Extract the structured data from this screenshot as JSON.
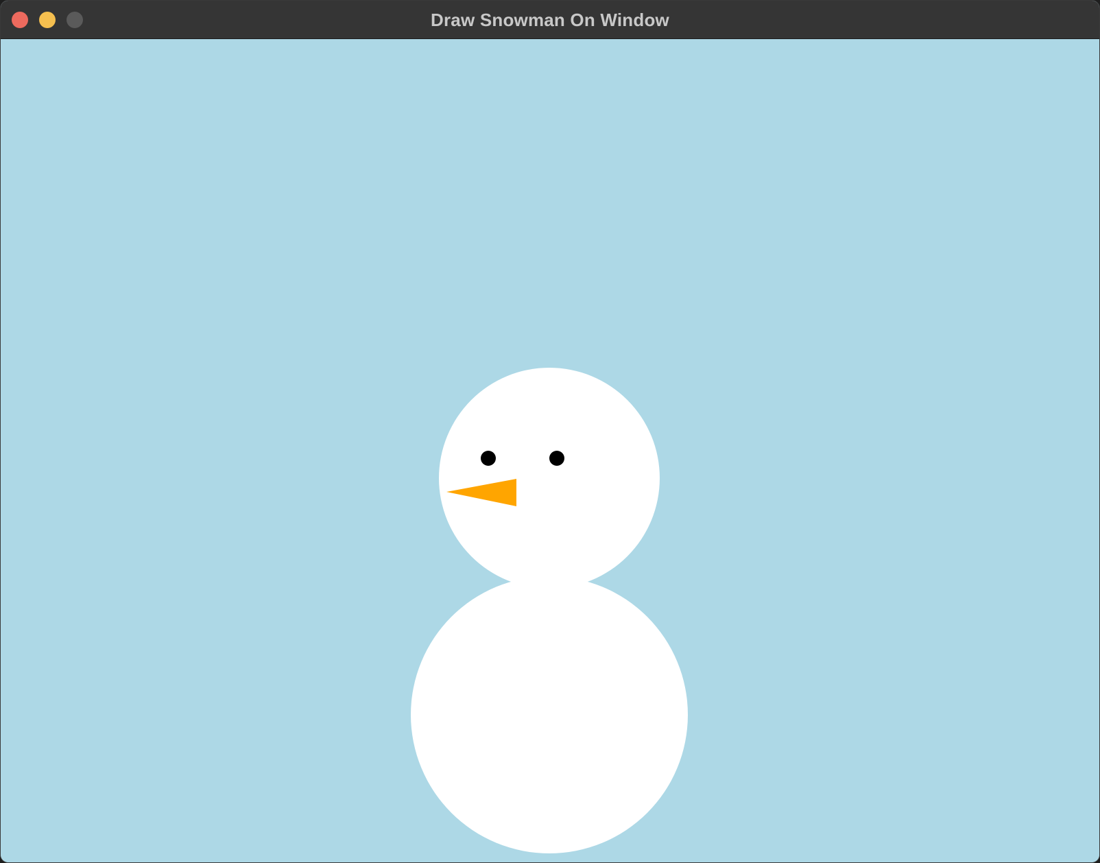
{
  "window": {
    "title": "Draw Snowman On Window",
    "controls": {
      "close_color": "#ed6a5e",
      "minimize_color": "#f5bf4f",
      "zoom_color": "#5a5a5a"
    }
  },
  "scene": {
    "background_color": "#add8e6",
    "snow_color": "#ffffff",
    "eye_color": "#000000",
    "nose_color": "#ffa500"
  }
}
